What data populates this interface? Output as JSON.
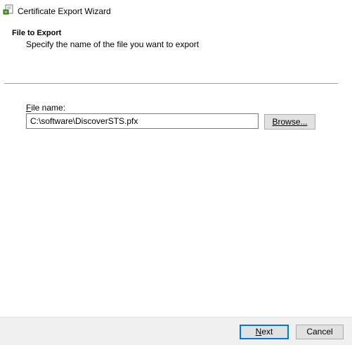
{
  "window": {
    "title": "Certificate Export Wizard"
  },
  "header": {
    "title": "File to Export",
    "subtitle": "Specify the name of the file you want to export"
  },
  "form": {
    "file_label_accel": "F",
    "file_label_rest": "ile name:",
    "file_value": "C:\\software\\DiscoverSTS.pfx",
    "browse_accel": "Browse...",
    "browse_label": "Browse..."
  },
  "footer": {
    "next_accel": "N",
    "next_rest": "ext",
    "cancel_label": "Cancel"
  },
  "colors": {
    "focus_border": "#0078d7",
    "footer_bg": "#f0f0f0",
    "button_bg": "#e1e1e1"
  },
  "icons": {
    "title": "certificate-wizard-icon"
  }
}
